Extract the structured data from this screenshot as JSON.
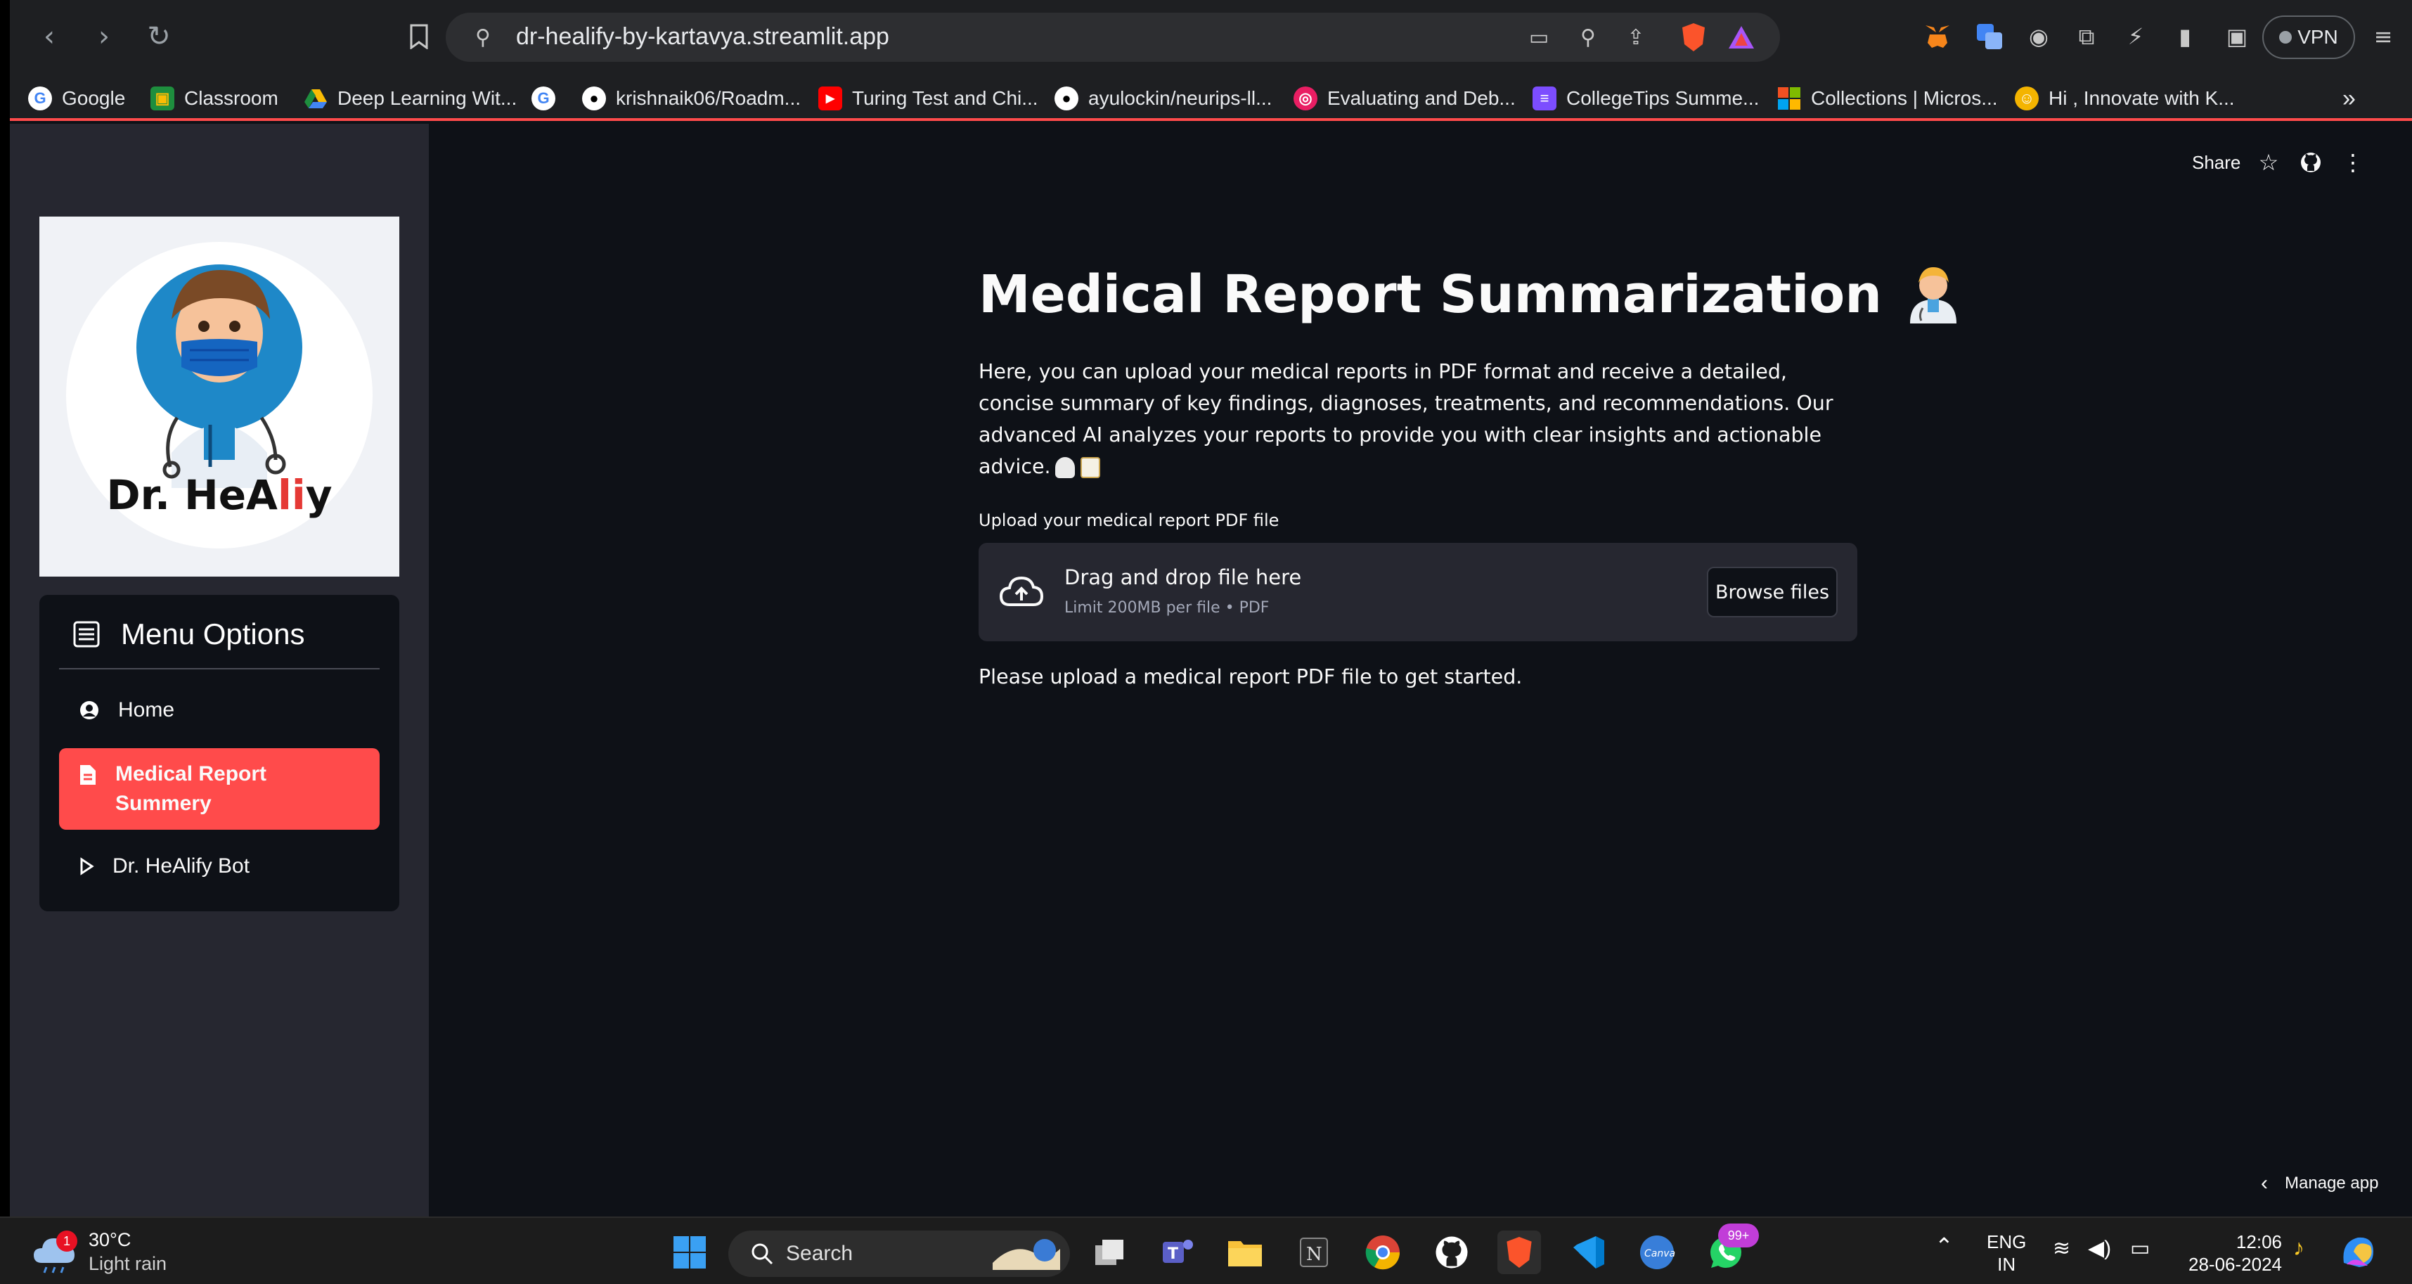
{
  "browser": {
    "url": "dr-healify-by-kartavya.streamlit.app",
    "vpn_label": "VPN",
    "bookmarks": [
      {
        "label": "Google",
        "icon": "google-icon"
      },
      {
        "label": "Classroom",
        "icon": "classroom-icon"
      },
      {
        "label": "Deep Learning Wit...",
        "icon": "drive-icon"
      },
      {
        "label": "",
        "icon": "google-icon"
      },
      {
        "label": "krishnaik06/Roadm...",
        "icon": "github-icon"
      },
      {
        "label": "Turing Test and Chi...",
        "icon": "youtube-icon"
      },
      {
        "label": "ayulockin/neurips-ll...",
        "icon": "github-icon"
      },
      {
        "label": "Evaluating and Deb...",
        "icon": "target-icon"
      },
      {
        "label": "CollegeTips Summe...",
        "icon": "list-icon"
      },
      {
        "label": "Collections | Micros...",
        "icon": "microsoft-icon"
      },
      {
        "label": "Hi , Innovate with K...",
        "icon": "avatar-icon"
      }
    ],
    "overflow_label": "»"
  },
  "sidebar": {
    "logo_text_prefix": "Dr. HeA",
    "logo_text_red": "li",
    "logo_text_suffix": "y",
    "menu_title": "Menu Options",
    "items": [
      {
        "label": "Home",
        "icon": "user-circle-icon"
      },
      {
        "label": "Medical Report Summery",
        "icon": "file-icon",
        "active": true
      },
      {
        "label": "Dr. HeAlify Bot",
        "icon": "play-icon"
      }
    ]
  },
  "header": {
    "share_label": "Share"
  },
  "main": {
    "title": "Medical Report Summarization",
    "description": "Here, you can upload your medical reports in PDF format and receive a detailed, concise summary of key findings, diagnoses, treatments, and recommendations. Our advanced AI analyzes your reports to provide you with clear insights and actionable advice.",
    "upload_label": "Upload your medical report PDF file",
    "dropzone_title": "Drag and drop file here",
    "dropzone_limit": "Limit 200MB per file • PDF",
    "browse_label": "Browse files",
    "hint": "Please upload a medical report PDF file to get started."
  },
  "footer": {
    "manage_label": "Manage app"
  },
  "taskbar": {
    "weather_badge": "1",
    "temperature": "30°C",
    "weather_desc": "Light rain",
    "search_label": "Search",
    "whatsapp_badge": "99+",
    "lang_top": "ENG",
    "lang_bottom": "IN",
    "time": "12:06",
    "date": "28-06-2024"
  },
  "colors": {
    "accent": "#ff4b4b",
    "app_background": "#0e1117",
    "sidebar_background": "#262730"
  }
}
